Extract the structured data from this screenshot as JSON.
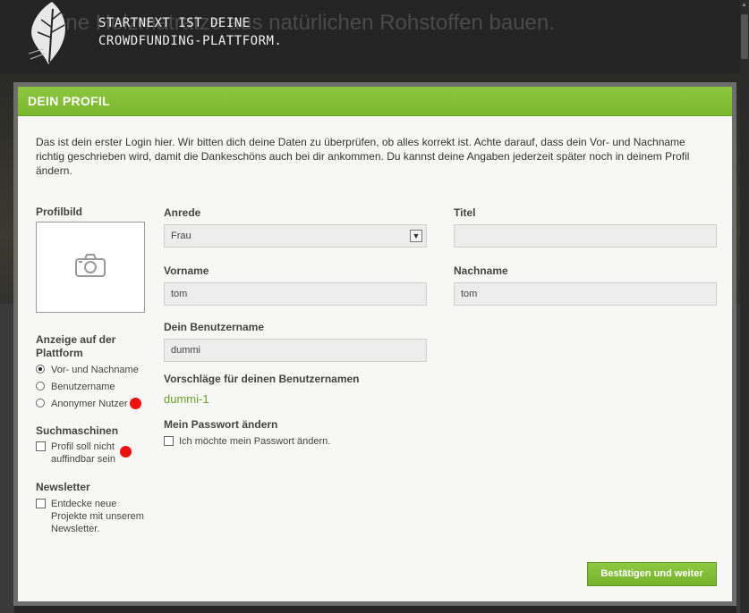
{
  "background": {
    "headline": "Eine Holzmatratze aus natürlichen Rohstoffen bauen.",
    "tagline_line1": "STARTNEXT IST DEINE",
    "tagline_line2": "CROWDFUNDING-PLATTFORM."
  },
  "modal": {
    "title": "DEIN PROFIL",
    "intro": "Das ist dein erster Login hier. Wir bitten dich deine Daten zu überprüfen, ob alles korrekt ist. Achte darauf, dass dein Vor- und Nachname richtig geschrieben wird, damit die Dankeschöns auch bei dir ankommen. Du kannst deine Angaben jederzeit später noch in deinem Profil ändern.",
    "profile_picture_label": "Profilbild",
    "display_label": "Anzeige auf der Plattform",
    "display_options": [
      {
        "label": "Vor- und Nachname",
        "checked": true
      },
      {
        "label": "Benutzername",
        "checked": false
      },
      {
        "label": "Anonymer Nutzer",
        "checked": false
      }
    ],
    "search_label": "Suchmaschinen",
    "search_option": "Profil soll nicht auffindbar sein",
    "newsletter_label": "Newsletter",
    "newsletter_option": "Entdecke neue Projekte mit unserem Newsletter.",
    "salutation_label": "Anrede",
    "salutation_value": "Frau",
    "title_label": "Titel",
    "title_value": "",
    "firstname_label": "Vorname",
    "firstname_value": "tom",
    "lastname_label": "Nachname",
    "lastname_value": "tom",
    "username_label": "Dein Benutzername",
    "username_value": "dummi",
    "suggestions_label": "Vorschläge für deinen Benutzernamen",
    "suggestion": "dummi-1",
    "password_label": "Mein Passwort ändern",
    "password_option": "Ich möchte mein Passwort ändern.",
    "confirm_button": "Bestätigen und weiter"
  },
  "colors": {
    "accent_green": "#7cb82f",
    "marker_red": "#ee1111"
  },
  "icons": {
    "photo": "camera-icon",
    "logo": "leaf-logo-icon"
  }
}
